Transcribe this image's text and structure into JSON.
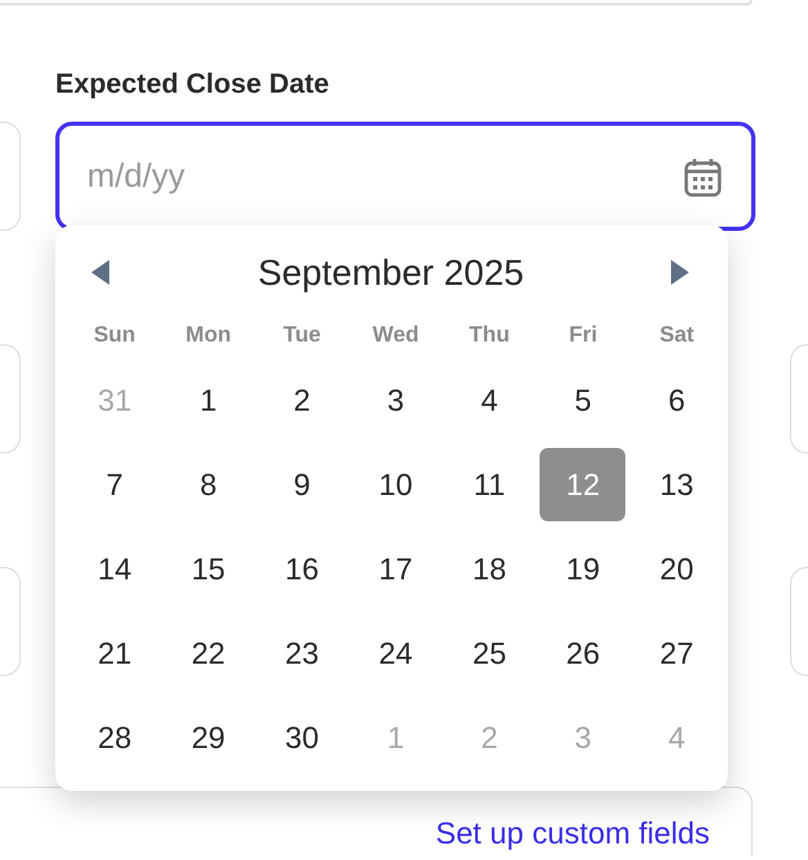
{
  "label": "Expected Close Date",
  "date_field": {
    "placeholder": "m/d/yy",
    "focused": true
  },
  "calendar": {
    "month": "September 2025",
    "weekdays": [
      "Sun",
      "Mon",
      "Tue",
      "Wed",
      "Thu",
      "Fri",
      "Sat"
    ],
    "weeks": [
      [
        {
          "day": "31",
          "outside": true,
          "selected": false
        },
        {
          "day": "1",
          "outside": false,
          "selected": false
        },
        {
          "day": "2",
          "outside": false,
          "selected": false
        },
        {
          "day": "3",
          "outside": false,
          "selected": false
        },
        {
          "day": "4",
          "outside": false,
          "selected": false
        },
        {
          "day": "5",
          "outside": false,
          "selected": false
        },
        {
          "day": "6",
          "outside": false,
          "selected": false
        }
      ],
      [
        {
          "day": "7",
          "outside": false,
          "selected": false
        },
        {
          "day": "8",
          "outside": false,
          "selected": false
        },
        {
          "day": "9",
          "outside": false,
          "selected": false
        },
        {
          "day": "10",
          "outside": false,
          "selected": false
        },
        {
          "day": "11",
          "outside": false,
          "selected": false
        },
        {
          "day": "12",
          "outside": false,
          "selected": true
        },
        {
          "day": "13",
          "outside": false,
          "selected": false
        }
      ],
      [
        {
          "day": "14",
          "outside": false,
          "selected": false
        },
        {
          "day": "15",
          "outside": false,
          "selected": false
        },
        {
          "day": "16",
          "outside": false,
          "selected": false
        },
        {
          "day": "17",
          "outside": false,
          "selected": false
        },
        {
          "day": "18",
          "outside": false,
          "selected": false
        },
        {
          "day": "19",
          "outside": false,
          "selected": false
        },
        {
          "day": "20",
          "outside": false,
          "selected": false
        }
      ],
      [
        {
          "day": "21",
          "outside": false,
          "selected": false
        },
        {
          "day": "22",
          "outside": false,
          "selected": false
        },
        {
          "day": "23",
          "outside": false,
          "selected": false
        },
        {
          "day": "24",
          "outside": false,
          "selected": false
        },
        {
          "day": "25",
          "outside": false,
          "selected": false
        },
        {
          "day": "26",
          "outside": false,
          "selected": false
        },
        {
          "day": "27",
          "outside": false,
          "selected": false
        }
      ],
      [
        {
          "day": "28",
          "outside": false,
          "selected": false
        },
        {
          "day": "29",
          "outside": false,
          "selected": false
        },
        {
          "day": "30",
          "outside": false,
          "selected": false
        },
        {
          "day": "1",
          "outside": true,
          "selected": false
        },
        {
          "day": "2",
          "outside": true,
          "selected": false
        },
        {
          "day": "3",
          "outside": true,
          "selected": false
        },
        {
          "day": "4",
          "outside": true,
          "selected": false
        }
      ]
    ]
  },
  "link": "Set up custom fields"
}
